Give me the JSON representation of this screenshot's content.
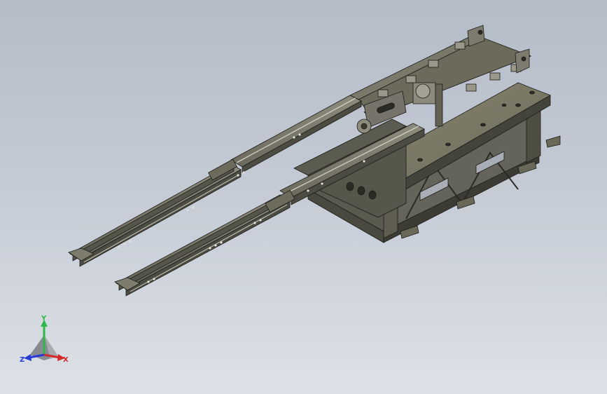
{
  "viewport": {
    "background_top": "#b4bcc8",
    "background_bottom": "#dde1e7"
  },
  "model": {
    "body_color": "#6e6c5e",
    "body_light": "#8a8878",
    "body_dark": "#45443b",
    "edge_color": "#1c1c18",
    "highlight": "#c9c8bd"
  },
  "triad": {
    "x_label": "X",
    "y_label": "Y",
    "z_label": "Z",
    "x_color": "#d42a2a",
    "y_color": "#2db84a",
    "z_color": "#2a3ad4"
  }
}
